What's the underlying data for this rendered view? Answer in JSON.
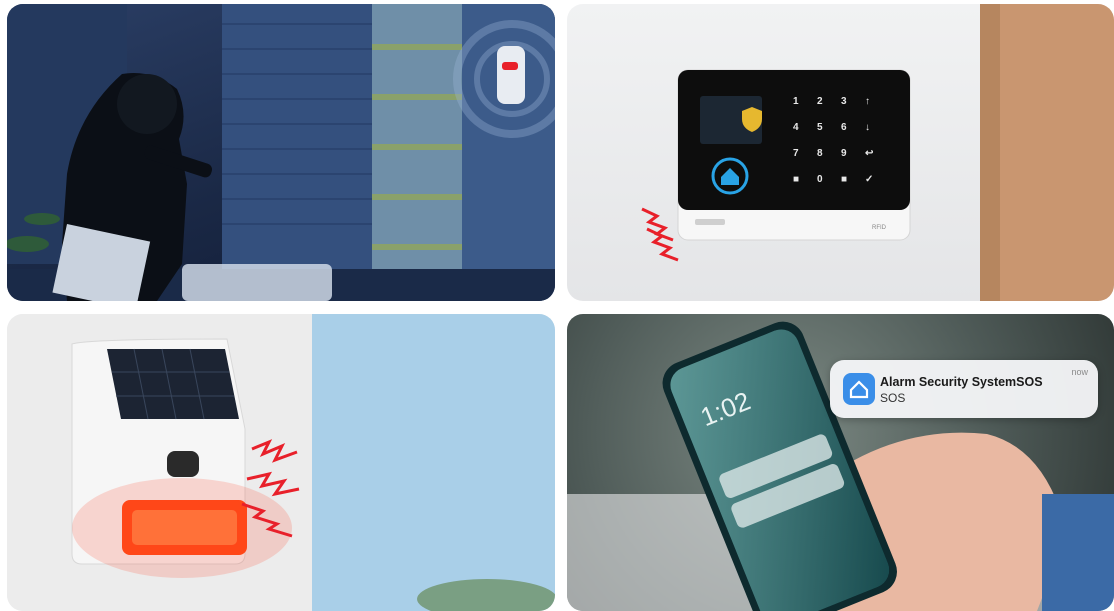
{
  "panels": [
    {
      "name": "intruder-motion-sensor"
    },
    {
      "name": "alarm-control-panel",
      "rfid_label": "RFID"
    },
    {
      "name": "solar-siren"
    },
    {
      "name": "phone-notification",
      "notification": {
        "title": "Alarm Security SystemSOS",
        "body": "SOS",
        "time": "now"
      },
      "phone_clock": "1:02"
    }
  ],
  "colors": {
    "alert_red": "#e8202a",
    "app_blue": "#3a8ee8",
    "keypad_black": "#0d0d0d"
  },
  "icons": [
    "house-icon",
    "shield-check-icon",
    "alarm-waves-icon",
    "lock-icon"
  ]
}
